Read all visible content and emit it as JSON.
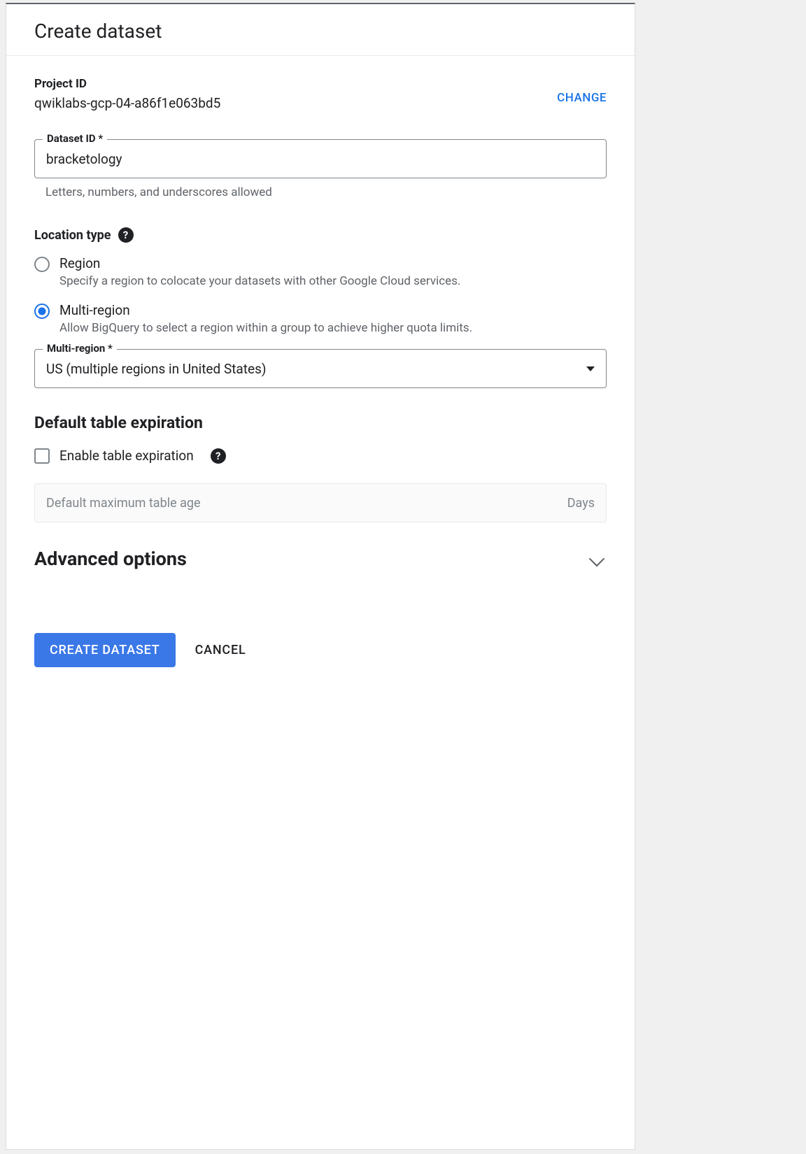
{
  "title": "Create dataset",
  "project": {
    "label": "Project ID",
    "value": "qwiklabs-gcp-04-a86f1e063bd5",
    "change_label": "CHANGE"
  },
  "dataset_id": {
    "label": "Dataset ID *",
    "value": "bracketology",
    "helper": "Letters, numbers, and underscores allowed"
  },
  "location": {
    "heading": "Location type",
    "options": [
      {
        "label": "Region",
        "desc": "Specify a region to colocate your datasets with other Google Cloud services.",
        "checked": false
      },
      {
        "label": "Multi-region",
        "desc": "Allow BigQuery to select a region within a group to achieve higher quota limits.",
        "checked": true
      }
    ],
    "select": {
      "label": "Multi-region *",
      "value": "US (multiple regions in United States)"
    }
  },
  "expiration": {
    "heading": "Default table expiration",
    "checkbox_label": "Enable table expiration",
    "placeholder": "Default maximum table age",
    "suffix": "Days"
  },
  "advanced": {
    "heading": "Advanced options"
  },
  "buttons": {
    "create": "CREATE DATASET",
    "cancel": "CANCEL"
  }
}
